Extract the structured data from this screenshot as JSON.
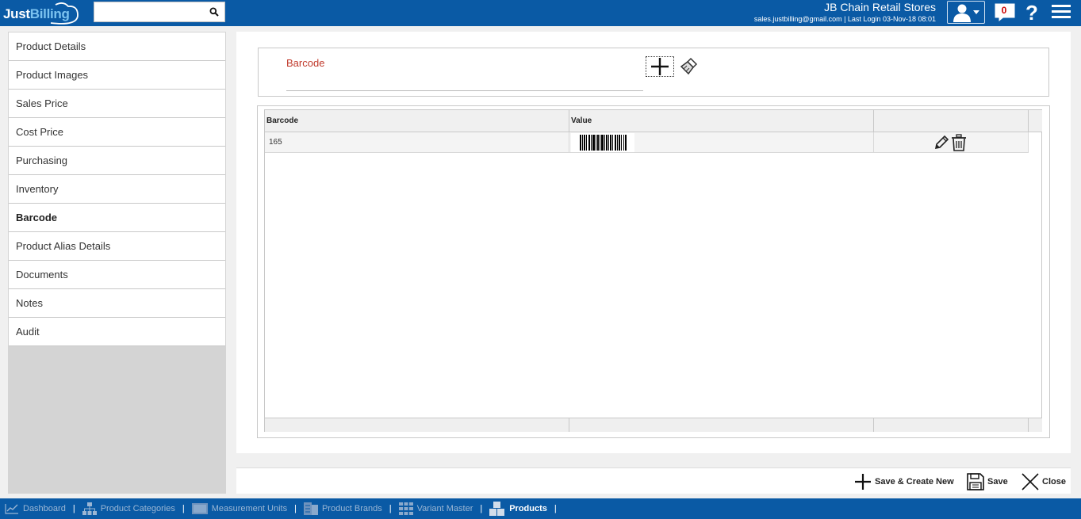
{
  "header": {
    "logo_just": "Just",
    "logo_billing": "Billing",
    "search_placeholder": "",
    "company": "JB Chain Retail Stores",
    "login_info": "sales.justbilling@gmail.com | Last Login 03-Nov-18 08:01",
    "notification_count": "0",
    "help_label": "?"
  },
  "sidebar": {
    "items": [
      {
        "label": "Product Details"
      },
      {
        "label": "Product Images"
      },
      {
        "label": "Sales Price"
      },
      {
        "label": "Cost Price"
      },
      {
        "label": "Purchasing"
      },
      {
        "label": "Inventory"
      },
      {
        "label": "Barcode"
      },
      {
        "label": "Product Alias Details"
      },
      {
        "label": "Documents"
      },
      {
        "label": "Notes"
      },
      {
        "label": "Audit"
      }
    ],
    "active_index": 6
  },
  "form": {
    "label": "Barcode",
    "value": ""
  },
  "grid": {
    "columns": [
      "Barcode",
      "Value",
      ""
    ],
    "rows": [
      {
        "barcode": "165"
      }
    ]
  },
  "actions": {
    "save_create_new": "Save & Create New",
    "save": "Save",
    "close": "Close"
  },
  "bottom_nav": {
    "items": [
      {
        "label": "Dashboard",
        "icon": "line-chart-icon"
      },
      {
        "label": "Product Categories",
        "icon": "hierarchy-icon"
      },
      {
        "label": "Measurement Units",
        "icon": "ruler-icon"
      },
      {
        "label": "Product Brands",
        "icon": "brand-icon"
      },
      {
        "label": "Variant Master",
        "icon": "grid-icon"
      },
      {
        "label": "Products",
        "icon": "boxes-icon"
      }
    ],
    "active_index": 5
  },
  "colors": {
    "header_bg": "#0a5aa5",
    "label_red": "#c0392b",
    "logo_light": "#7cc3f0"
  }
}
